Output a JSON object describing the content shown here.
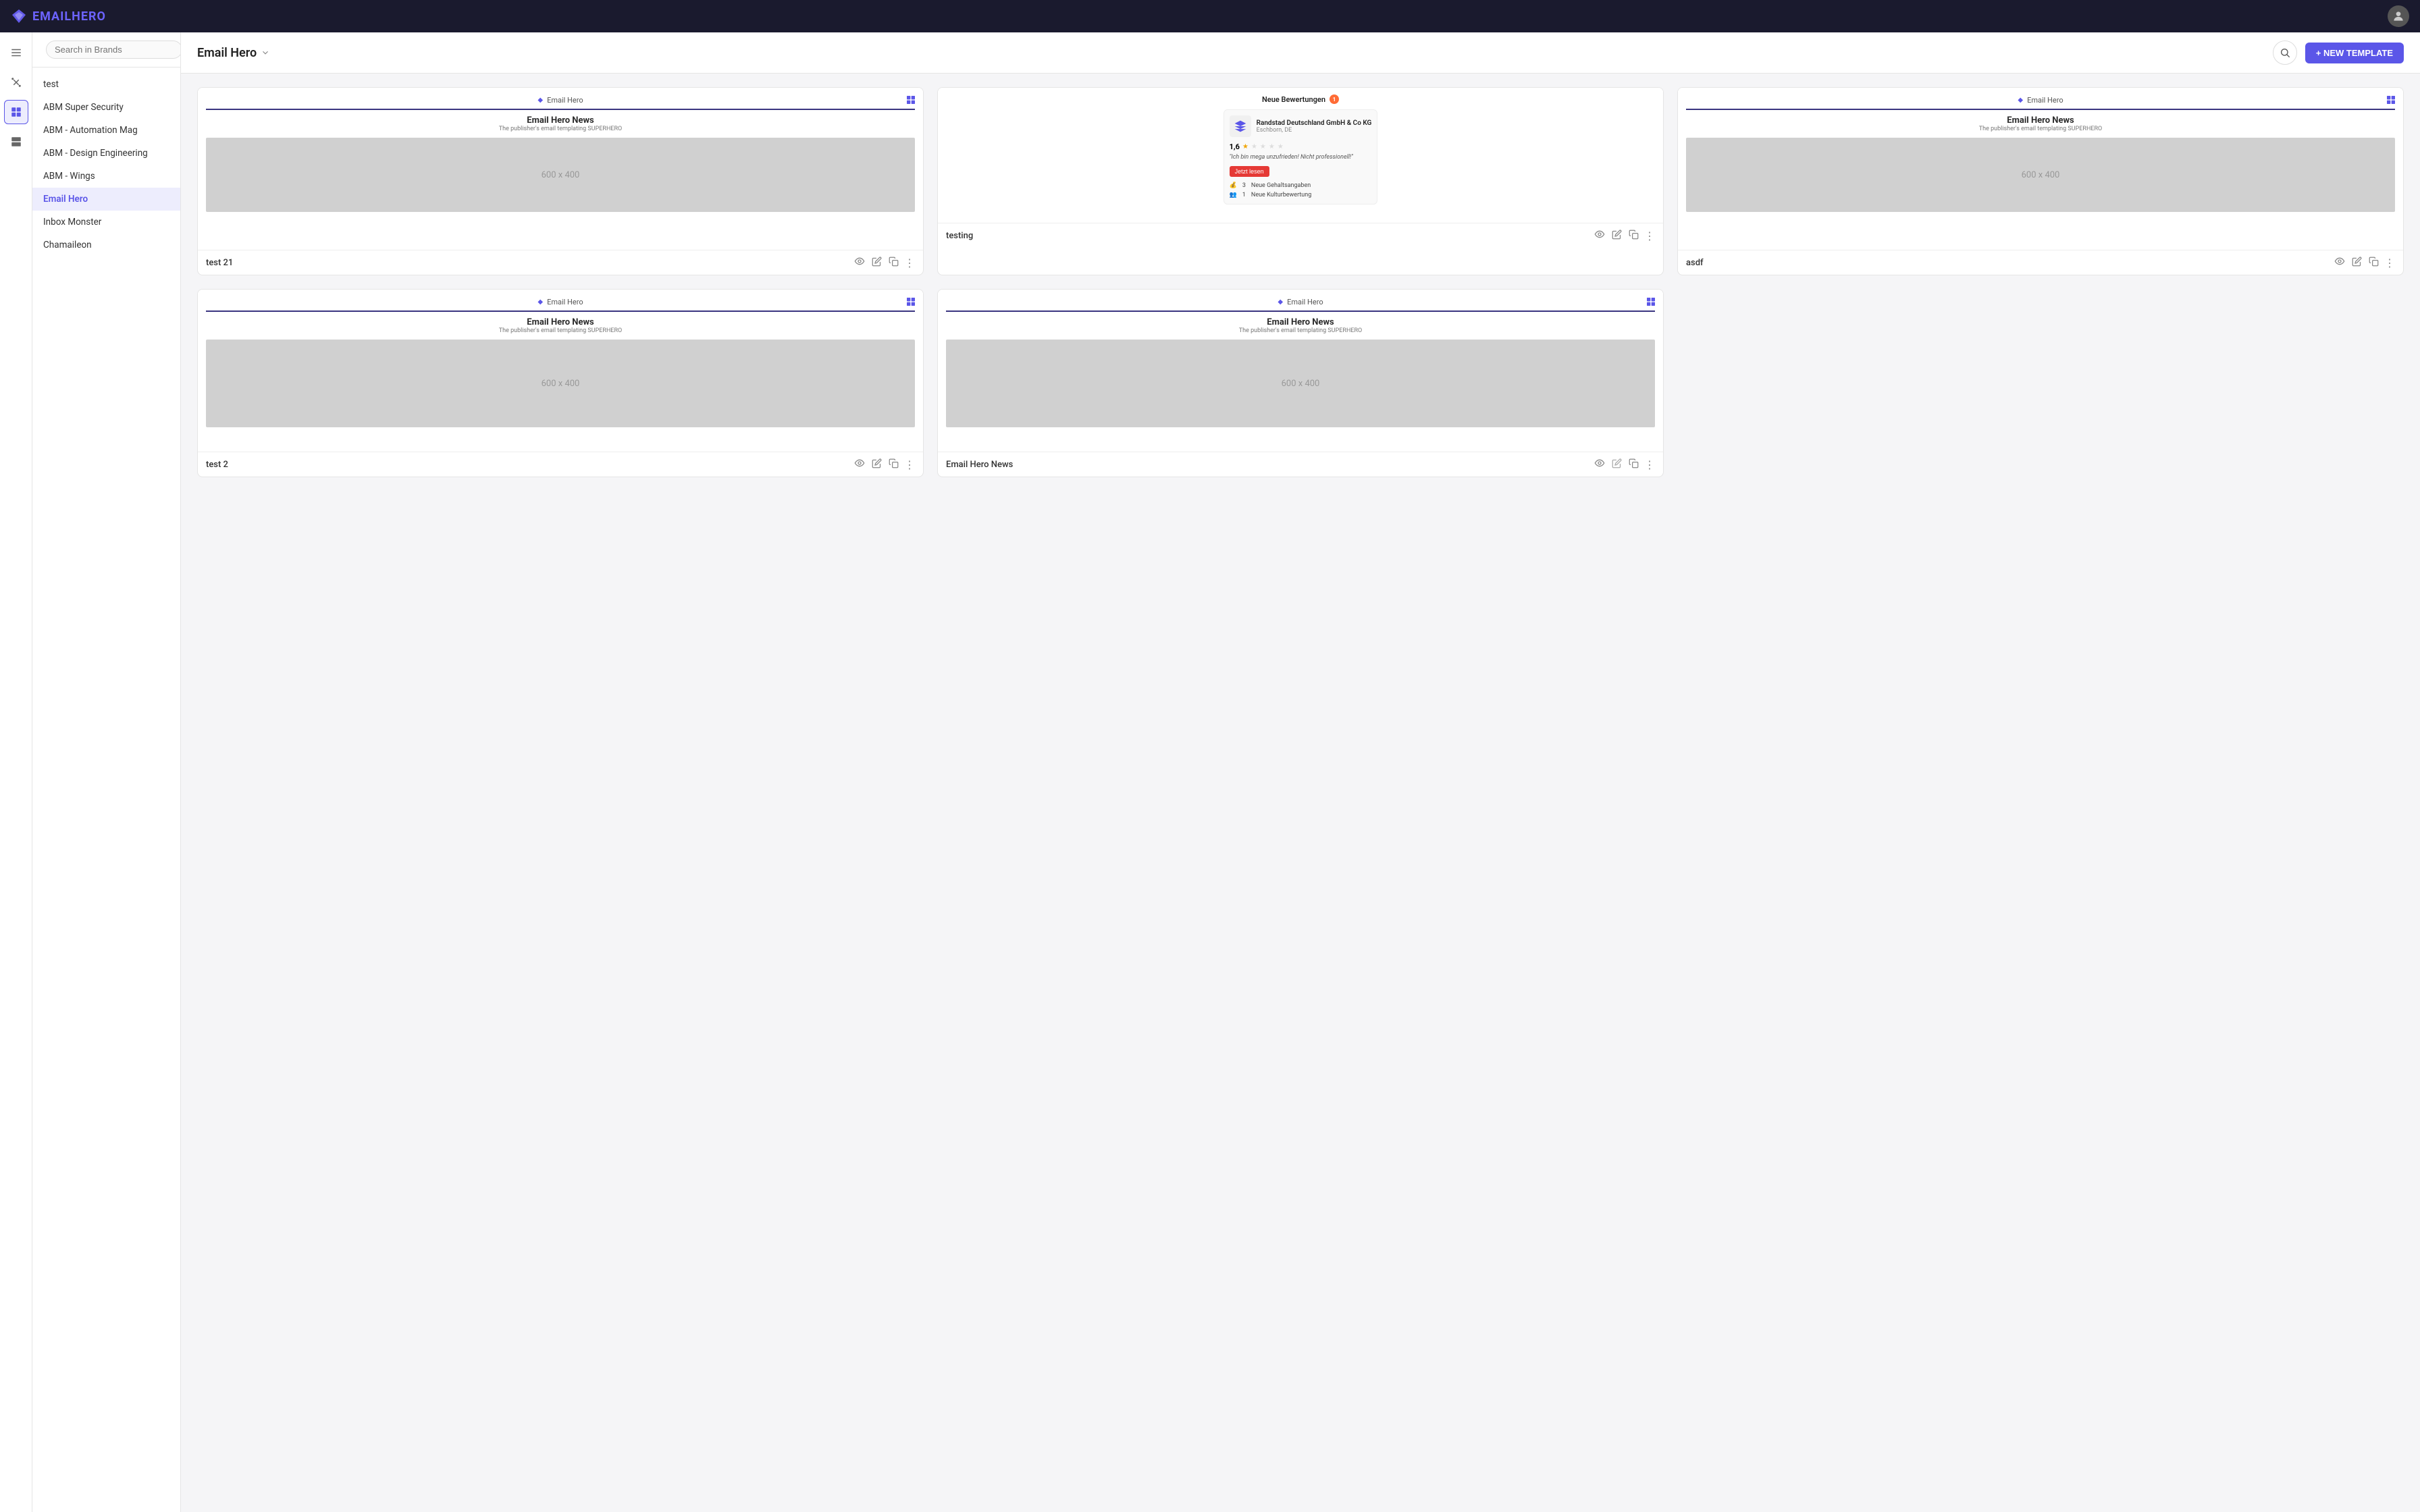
{
  "app": {
    "name": "EMAIL",
    "name_accent": "HERO",
    "logo_symbol": "◆"
  },
  "topnav": {
    "avatar_icon": "👤"
  },
  "sidebar": {
    "search_placeholder": "Search in Brands",
    "items": [
      {
        "id": "test",
        "label": "test",
        "active": false
      },
      {
        "id": "abm-super-security",
        "label": "ABM Super Security",
        "active": false
      },
      {
        "id": "abm-automation-mag",
        "label": "ABM - Automation Mag",
        "active": false
      },
      {
        "id": "abm-design-engineering",
        "label": "ABM - Design Engineering",
        "active": false
      },
      {
        "id": "abm-wings",
        "label": "ABM - Wings",
        "active": false
      },
      {
        "id": "email-hero",
        "label": "Email Hero",
        "active": true
      },
      {
        "id": "inbox-monster",
        "label": "Inbox Monster",
        "active": false
      },
      {
        "id": "chamaileon",
        "label": "Chamaileon",
        "active": false
      }
    ]
  },
  "icon_bar": {
    "items": [
      {
        "id": "grid-1",
        "icon": "☰",
        "active": false
      },
      {
        "id": "tools",
        "icon": "✂",
        "active": false
      },
      {
        "id": "grid-2",
        "icon": "⊞",
        "active": true
      },
      {
        "id": "grid-3",
        "icon": "⊟",
        "active": false
      }
    ]
  },
  "content": {
    "title": "Email Hero",
    "new_template_label": "+ NEW TEMPLATE",
    "templates": [
      {
        "id": "test21",
        "name": "test 21",
        "type": "email-hero",
        "brand_label": "Email Hero",
        "email_title": "Email Hero News",
        "email_subtitle": "The publisher's email templating SUPERHERO",
        "image_text": "600 x 400",
        "has_grid_icon": true,
        "special": false
      },
      {
        "id": "testing",
        "name": "testing",
        "type": "review",
        "brand_label": "Neue Bewertungen",
        "has_grid_icon": false,
        "special": true,
        "review": {
          "neue_badge": "●",
          "header": "Neue Bewertungen",
          "notification_count": "1",
          "company": "Randstad Deutschland GmbH & Co KG",
          "location": "Eschborn, DE",
          "score": "1,6",
          "stars": 1,
          "quote": "\"Ich bin mega unzufrieden! Nicht professionell!\"",
          "btn_label": "Jetzt lesen",
          "stats": [
            {
              "count": "3",
              "label": "Neue Gehaltsangaben"
            },
            {
              "count": "1",
              "label": "Neue Kulturbewertung"
            }
          ]
        }
      },
      {
        "id": "asdf",
        "name": "asdf",
        "type": "email-hero",
        "brand_label": "Email Hero",
        "email_title": "Email Hero News",
        "email_subtitle": "The publisher's email templating SUPERHERO",
        "image_text": "600 x 400",
        "has_grid_icon": true,
        "special": false
      },
      {
        "id": "test2",
        "name": "test 2",
        "type": "email-hero",
        "brand_label": "Email Hero",
        "email_title": "Email Hero News",
        "email_subtitle": "The publisher's email templating SUPERHERO",
        "image_text": "600 x 400",
        "has_grid_icon": true,
        "special": false
      },
      {
        "id": "email-hero-news",
        "name": "Email Hero News",
        "type": "email-hero",
        "brand_label": "Email Hero",
        "email_title": "Email Hero News",
        "email_subtitle": "The publisher's email templating SUPERHERO",
        "image_text": "600 x 400",
        "has_grid_icon": true,
        "special": false
      }
    ]
  }
}
